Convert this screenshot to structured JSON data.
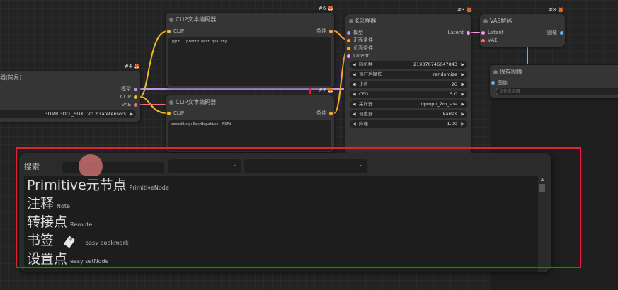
{
  "nodes": {
    "loader": {
      "badge_num": "#4",
      "title": "器(简易)",
      "out_model": "模型",
      "out_clip": "CLIP",
      "out_vae": "VAE",
      "ckpt_value": "3DMR 3DQ _SDXL V0.2.safetensors"
    },
    "clip_pos": {
      "badge_num": "#6",
      "title": "CLIP文本编码器",
      "in_clip": "CLIP",
      "out_cond": "条件",
      "text": "(girl),pretty,best quality"
    },
    "clip_neg": {
      "badge_num": "#7",
      "title": "CLIP文本编码器",
      "in_clip": "CLIP",
      "out_cond": "条件",
      "text": "embedding:EasyNegative, NSFW"
    },
    "ksampler": {
      "badge_num": "#3",
      "title": "K采样器",
      "in_model": "模型",
      "in_pos": "正面条件",
      "in_neg": "负面条件",
      "in_latent": "Latent",
      "widgets": [
        {
          "label": "随机种",
          "value": "219370746647843"
        },
        {
          "label": "运行后操作",
          "value": "randomize"
        },
        {
          "label": "步数",
          "value": "20"
        },
        {
          "label": "CFG",
          "value": "5.0"
        },
        {
          "label": "采样器",
          "value": "dpmpp_2m_sde"
        },
        {
          "label": "调度器",
          "value": "karras"
        },
        {
          "label": "降噪",
          "value": "1.00"
        }
      ]
    },
    "vae_decode": {
      "badge_num": "#8",
      "title": "VAE解码",
      "in_latent": "Latent",
      "in_vae": "VAE",
      "out_image": "图像"
    },
    "save_image": {
      "title": "保存图像",
      "in_image": "图像",
      "prefix_placeholder": "文件名前缀"
    },
    "left_latent_label": "Latent"
  },
  "search_panel": {
    "search_label": "搜索",
    "search_value": "",
    "filter1_value": "",
    "filter2_value": "",
    "results": [
      {
        "title": "Primitive元节点",
        "subtitle": "PrimitiveNode",
        "icon": ""
      },
      {
        "title": "注释",
        "subtitle": "Note",
        "icon": ""
      },
      {
        "title": "转接点",
        "subtitle": "Reroute",
        "icon": ""
      },
      {
        "title": "书签",
        "subtitle": "easy bookmark",
        "icon": "bookmark-icon"
      },
      {
        "title": "设置点",
        "subtitle": "easy setNode",
        "icon": ""
      }
    ]
  },
  "colors": {
    "highlight": "#e0242b",
    "wire_clip": "#f0c020",
    "wire_model": "#b39ddb",
    "wire_vae": "#ff6e6e",
    "wire_latent": "#ff9cf9",
    "wire_image": "#64b5f6",
    "wire_cond": "#ffa931"
  }
}
